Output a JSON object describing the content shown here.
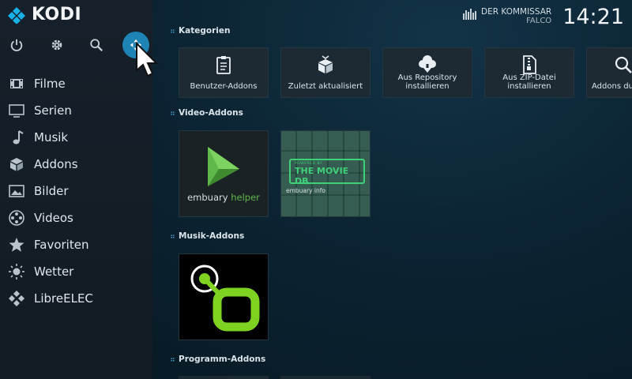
{
  "app": {
    "logo_text": "KODI"
  },
  "header": {
    "now_playing_title": "DER KOMMISSAR",
    "now_playing_subtitle": "FALCO",
    "clock": "14:21"
  },
  "topbar": [
    {
      "name": "power-icon"
    },
    {
      "name": "settings-gear-icon"
    },
    {
      "name": "search-icon"
    },
    {
      "name": "move-arrows-icon",
      "active": true
    }
  ],
  "menu": [
    {
      "label": "Filme",
      "icon": "film-icon"
    },
    {
      "label": "Serien",
      "icon": "tv-icon"
    },
    {
      "label": "Musik",
      "icon": "music-note-icon"
    },
    {
      "label": "Addons",
      "icon": "addons-box-icon"
    },
    {
      "label": "Bilder",
      "icon": "picture-icon"
    },
    {
      "label": "Videos",
      "icon": "film-reel-icon"
    },
    {
      "label": "Favoriten",
      "icon": "star-icon"
    },
    {
      "label": "Wetter",
      "icon": "sun-icon"
    },
    {
      "label": "LibreELEC",
      "icon": "libreelec-icon"
    }
  ],
  "sections": {
    "kategorien": "Kategorien",
    "video_addons": "Video-Addons",
    "musik_addons": "Musik-Addons",
    "programm_addons": "Programm-Addons"
  },
  "categories": [
    {
      "label": "Benutzer-Addons",
      "icon": "clipboard-list-icon"
    },
    {
      "label": "Zuletzt aktualisiert",
      "icon": "open-box-icon"
    },
    {
      "label": "Aus Repository installieren",
      "icon": "cloud-download-icon"
    },
    {
      "label": "Aus ZIP-Datei installieren",
      "icon": "zip-file-icon"
    },
    {
      "label": "Addons du",
      "icon": "search-icon"
    }
  ],
  "video_addons": [
    {
      "label": "embuary helper",
      "label_part1": "embuary",
      "label_part2": "helper"
    },
    {
      "label": "THE MOVIE DB",
      "top_text": "POWERED BY",
      "main_text": "THE MOVIE DB",
      "footer_text": "embuary info"
    }
  ],
  "colors": {
    "accent": "#1d84b5",
    "embuary_green": "#5fb94a",
    "tmdb_green": "#3fd07a",
    "music_green": "#7ed321"
  }
}
